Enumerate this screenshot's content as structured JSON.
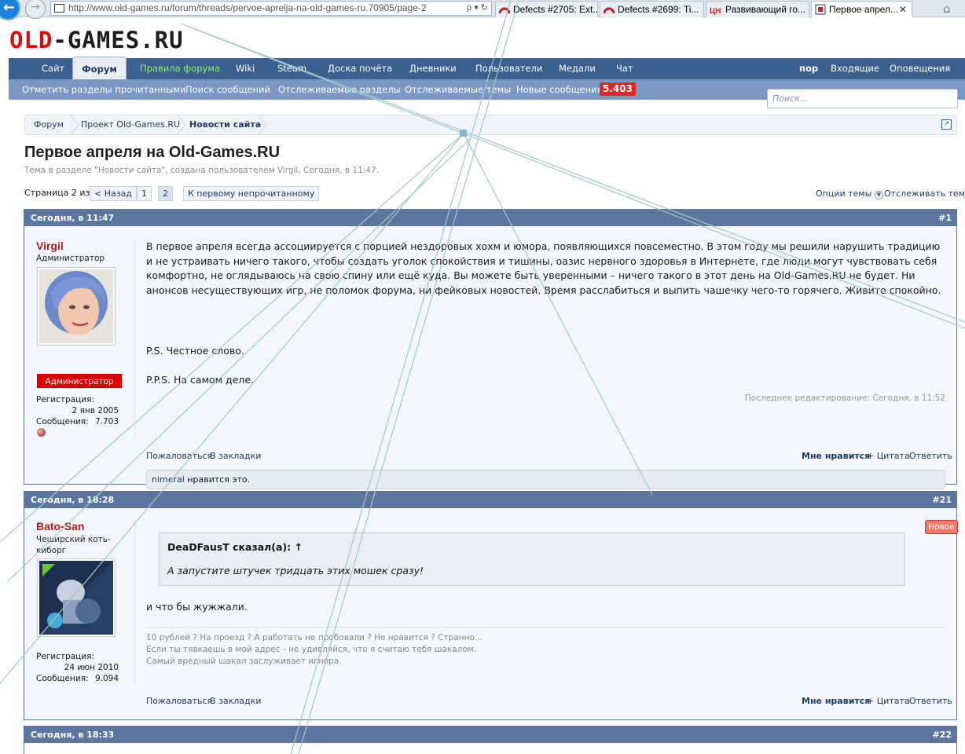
{
  "browser": {
    "url": "http://www.old-games.ru/forum/threads/pervoe-aprelja-na-old-games-ru.70905/page-2",
    "tabs": [
      {
        "label": "Defects #2705: Ext..."
      },
      {
        "label": "Defects #2699: Ti..."
      },
      {
        "label": "Развивающий го..."
      },
      {
        "label": "Первое апрел..."
      }
    ],
    "tab3_icon_text": "ЦН"
  },
  "logo": {
    "first": "OLD",
    "rest": "-GAMES.RU"
  },
  "nav": {
    "items": [
      "Сайт",
      "Форум",
      "Правила форума",
      "Wiki",
      "Steam",
      "Доска почёта",
      "Дневники",
      "Пользователи",
      "Медали",
      "Чат"
    ],
    "user": "пор",
    "inbox": "Входящие",
    "alerts": "Оповещения"
  },
  "subnav": {
    "items": [
      "Отметить разделы прочитанными",
      "Поиск сообщений",
      "Отслеживаемые разделы",
      "Отслеживаемые темы",
      "Новые сообщения"
    ],
    "badge": "5.403"
  },
  "search": {
    "placeholder": "Поиск..."
  },
  "breadcrumb": [
    "Форум",
    "Проект Old-Games.RU",
    "Новости сайта"
  ],
  "thread": {
    "title": "Первое апреля на Old-Games.RU",
    "desc": "Тема в разделе \"Новости сайта\", создана пользователем Virgil, Сегодня, в 11:47."
  },
  "pagination": {
    "label": "Страница 2 из 2",
    "prev": "< Назад",
    "pages": [
      "1",
      "2"
    ],
    "unread": "К первому непрочитанному",
    "options": "Опции темы",
    "watch": "Отслеживать тему"
  },
  "posts": [
    {
      "date": "Сегодня, в 11:47",
      "num": "#1",
      "user": "Virgil",
      "user_title": "Администратор",
      "role": "Администратор",
      "reg_label": "Регистрация:",
      "reg": "2 янв 2005",
      "msgs_label": "Сообщения:",
      "msgs": "7.703",
      "text": "В первое апреля всегда ассоциируется с порцией нездоровых хохм и юмора, появляющихся повсеместно. В этом году мы решили нарушить традицию и не устраивать ничего такого, чтобы создать уголок спокойствия и тишины, оазис нервного здоровья в Интернете, где люди могут чувствовать себя комфортно, не оглядываюсь на свою спину или ещё куда. Вы можете быть уверенными – ничего такого в этот день на Old-Games.RU не будет. Ни анонсов несуществующих игр, не поломок форума, ни фейковых новостей. Время расслабиться и выпить чашечку чего-то горячего. Живите спокойно.",
      "ps": "P.S. Честное слово.",
      "pps": "P.P.S. На самом деле.",
      "edit": "Последнее редактирование: Сегодня, в 11:52",
      "report": "Пожаловаться",
      "bookmark": "В закладки",
      "like": "Мне нравится",
      "quote": "+ Цитата",
      "reply": "Ответить",
      "liker": "nimeral",
      "likes_text": " нравится это."
    },
    {
      "date": "Сегодня, в 18:28",
      "num": "#21",
      "user": "Bato-San",
      "user_title": "Чеширский коть-киборг",
      "reg_label": "Регистрация:",
      "reg": "24 июн 2010",
      "msgs_label": "Сообщения:",
      "msgs": "9.094",
      "new_badge": "Новое",
      "quote_author": "DeaDFausT сказал(а): ↑",
      "quote_text": "А запустите штучек тридцать этих мошек сразу!",
      "text": "и что бы жужжали.",
      "sig": [
        "10 рублей ? На проезд ? А работать не пробовали ? Не нравится ? Странно...",
        "Если ты тявкаешь в мой адрес - не удивляйся, что я считаю тебя шакалом.",
        "Самый вредный шакал заслуживает игнора."
      ],
      "report": "Пожаловаться",
      "bookmark": "В закладки",
      "like": "Мне нравится",
      "quote": "+ Цитата",
      "reply": "Ответить"
    },
    {
      "date": "Сегодня, в 18:33",
      "num": "#22"
    }
  ],
  "colors": {
    "nav_bg": "#3b5f8e",
    "subnav_bg": "#7b98c4",
    "post_head": "#5d76a0",
    "username": "#b81a1a",
    "badge_red": "#e02626",
    "link": "#1f3a60"
  }
}
